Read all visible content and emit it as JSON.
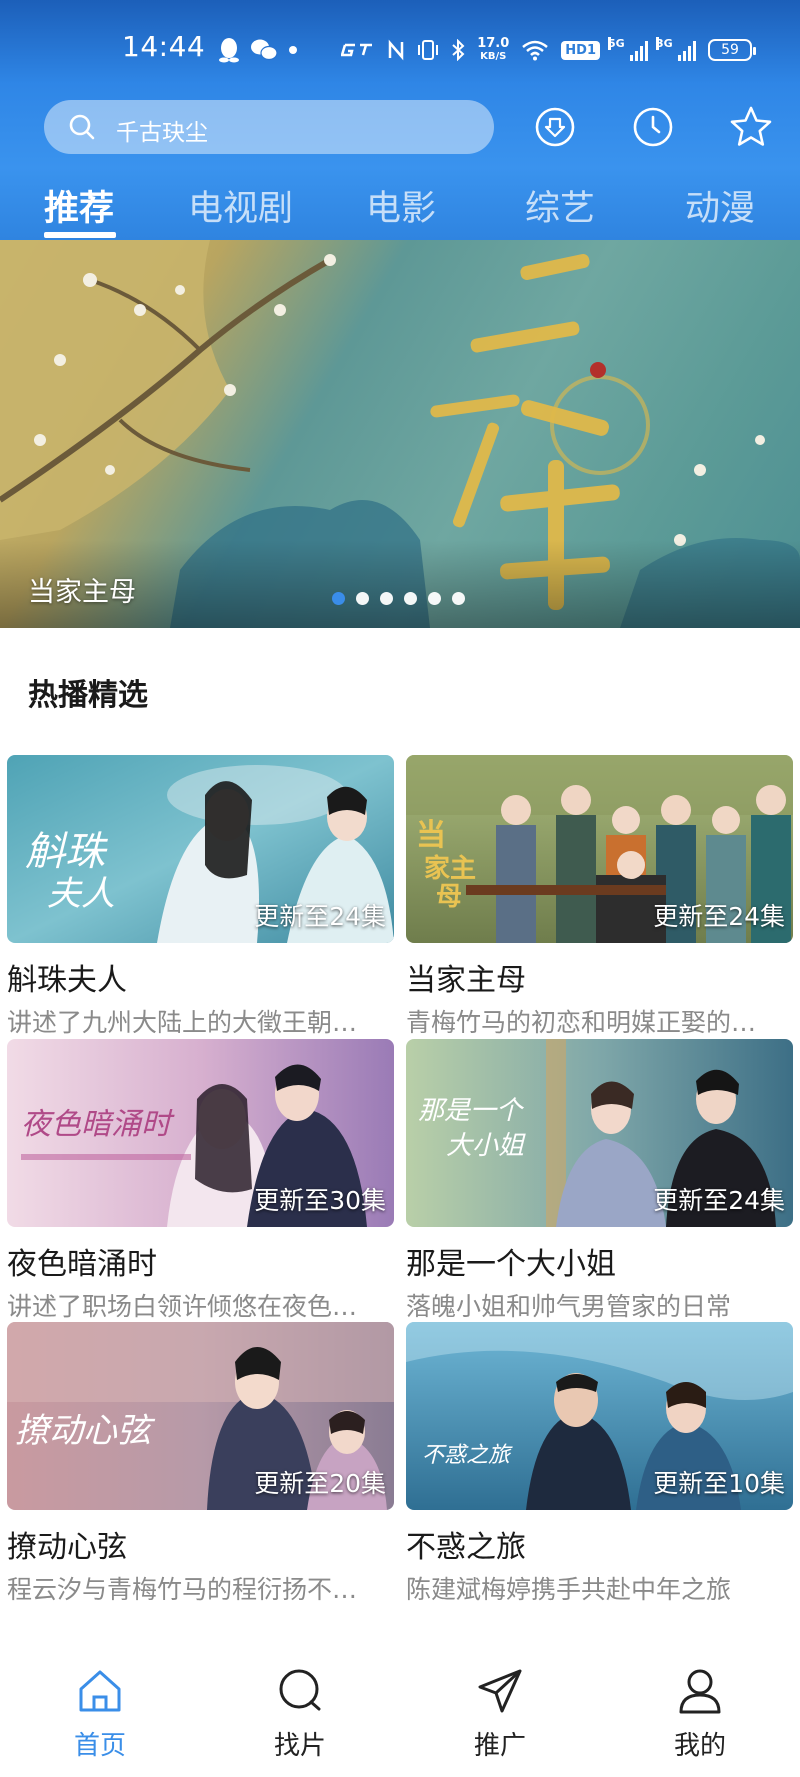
{
  "status_bar": {
    "time": "14:44",
    "net_speed_value": "17.0",
    "net_speed_unit": "KB/S",
    "hd_badge": "HD1",
    "sim1_label": "5G",
    "sim2_label": "3G",
    "battery": "59"
  },
  "search": {
    "text": "千古玦尘"
  },
  "tabs": [
    {
      "label": "推荐",
      "active": true
    },
    {
      "label": "电视剧",
      "active": false
    },
    {
      "label": "电影",
      "active": false
    },
    {
      "label": "综艺",
      "active": false
    },
    {
      "label": "动漫",
      "active": false
    }
  ],
  "banner": {
    "title": "当家主母",
    "poster_text": "当家主母",
    "dot_count": 6,
    "active_dot": 0
  },
  "section": {
    "title": "热播精选"
  },
  "cards": [
    {
      "title": "斛珠夫人",
      "desc": "讲述了九州大陆上的大徵王朝…",
      "episode": "更新至24集",
      "poster_text": "斛珠夫人"
    },
    {
      "title": "当家主母",
      "desc": "青梅竹马的初恋和明媒正娶的…",
      "episode": "更新至24集",
      "poster_text": "当家主母"
    },
    {
      "title": "夜色暗涌时",
      "desc": "讲述了职场白领许倾悠在夜色…",
      "episode": "更新至30集",
      "poster_text": "夜色暗涌时"
    },
    {
      "title": "那是一个大小姐",
      "desc": "落魄小姐和帅气男管家的日常",
      "episode": "更新至24集",
      "poster_text": "那是一个大小姐"
    },
    {
      "title": "撩动心弦",
      "desc": "程云汐与青梅竹马的程衍扬不…",
      "episode": "更新至20集",
      "poster_text": "撩动心弦"
    },
    {
      "title": "不惑之旅",
      "desc": "陈建斌梅婷携手共赴中年之旅",
      "episode": "更新至10集",
      "poster_text": "不惑之旅"
    }
  ],
  "bottom_nav": [
    {
      "label": "首页",
      "icon": "home-icon",
      "active": true
    },
    {
      "label": "找片",
      "icon": "search-icon",
      "active": false
    },
    {
      "label": "推广",
      "icon": "paper-plane-icon",
      "active": false
    },
    {
      "label": "我的",
      "icon": "user-icon",
      "active": false
    }
  ],
  "colors": {
    "header_top": "#1c5fb9",
    "header_bottom": "#2f84e0",
    "accent": "#3a8ee8"
  }
}
